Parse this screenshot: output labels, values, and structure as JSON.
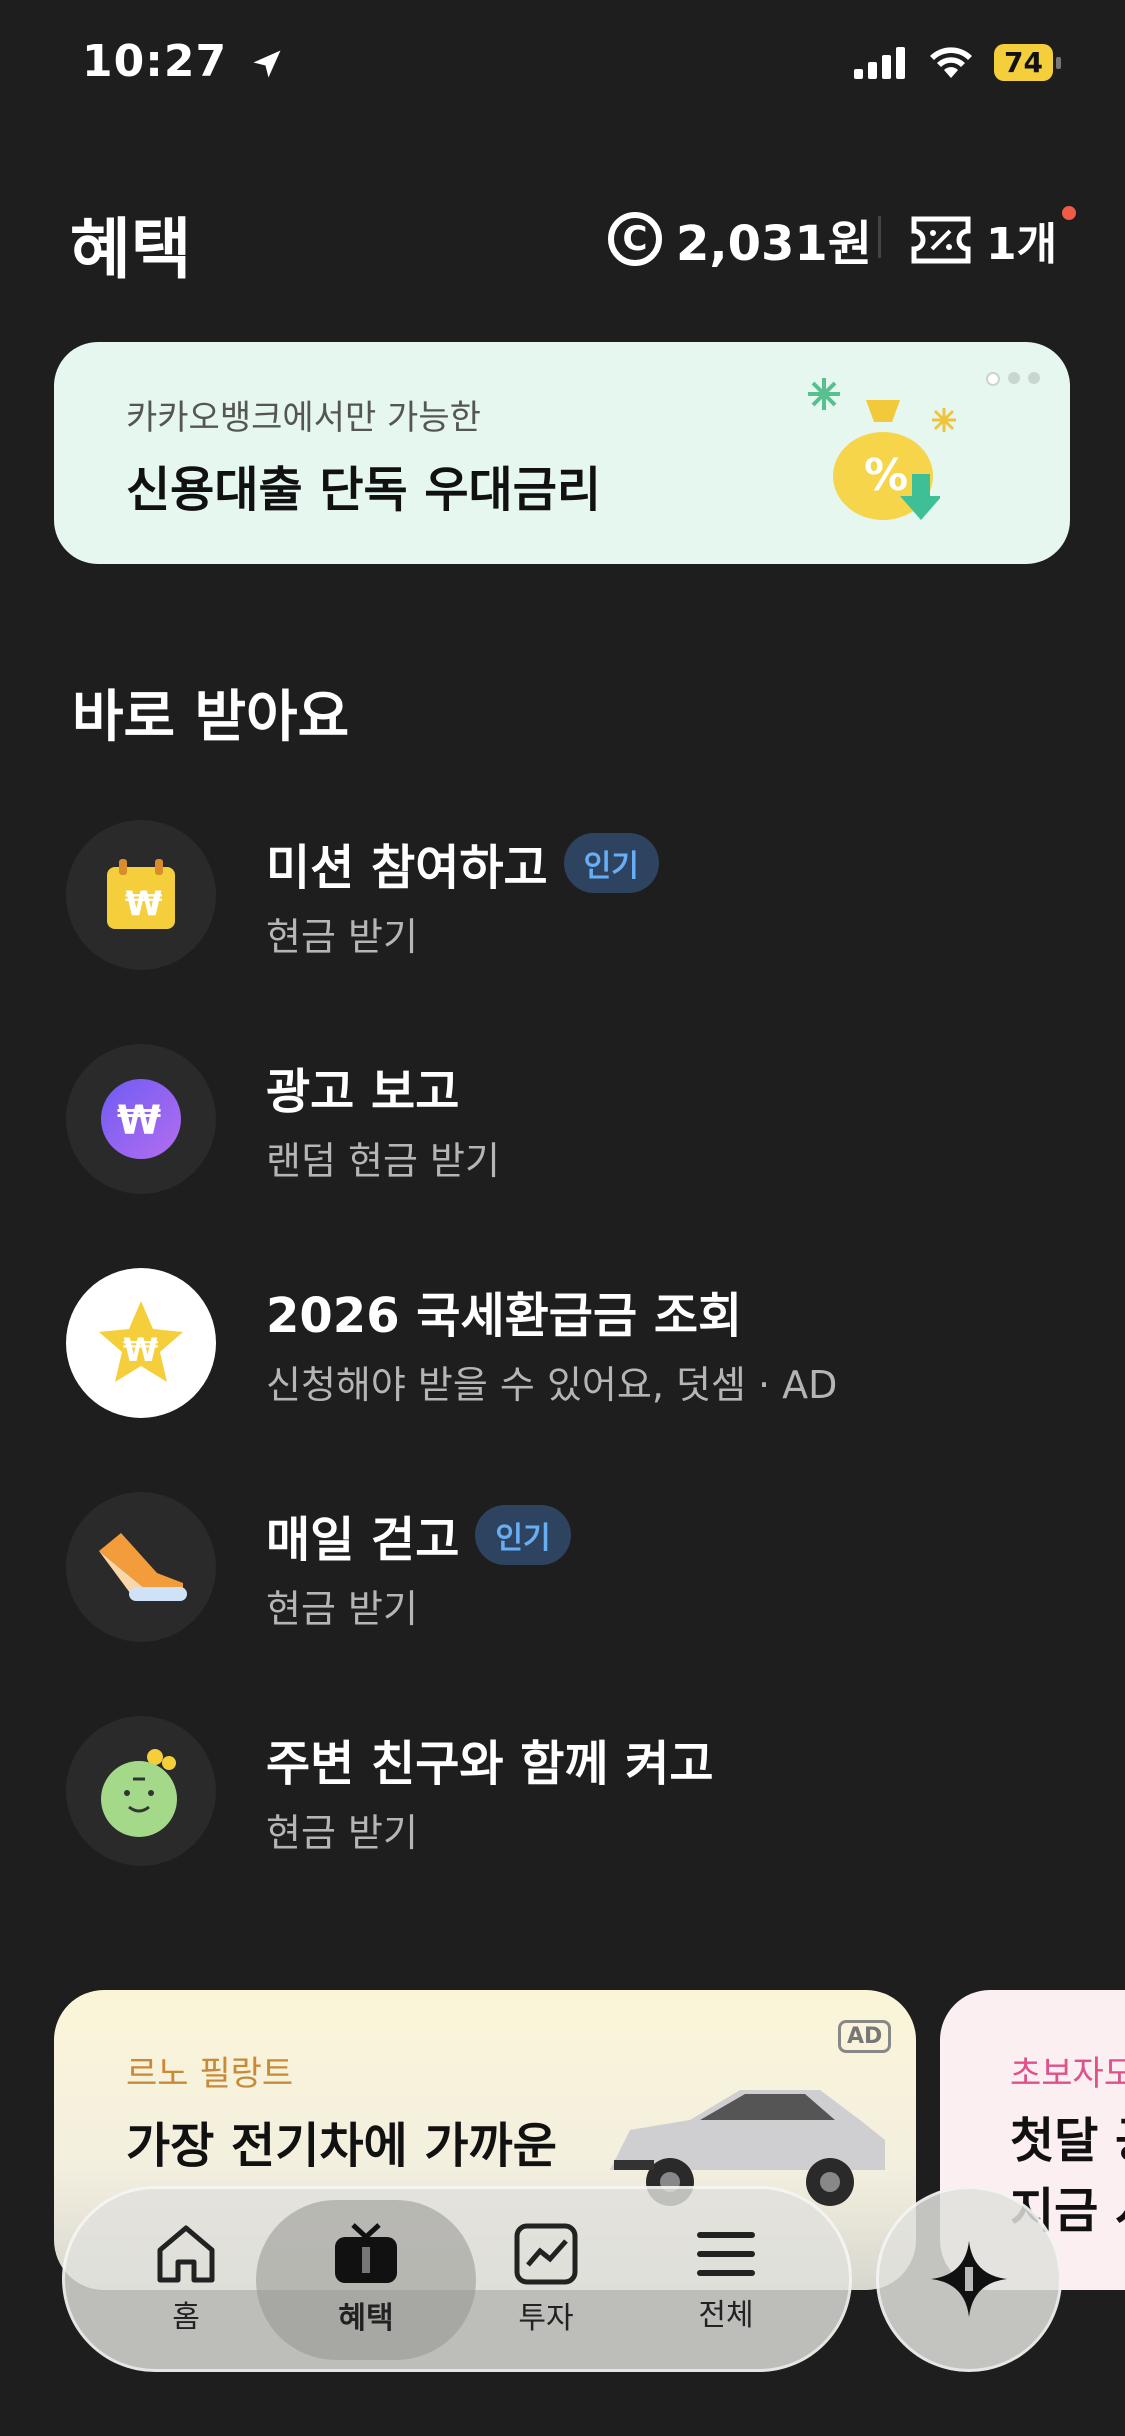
{
  "status_bar": {
    "time": "10:27",
    "battery": "74"
  },
  "header": {
    "title": "혜택",
    "points": "2,031원",
    "coupons": "1개",
    "coin_glyph": "C"
  },
  "banner": {
    "subtitle": "카카오뱅크에서만 가능한",
    "title": "신용대출 단독 우대금리"
  },
  "section": {
    "title": "바로 받아요",
    "items": [
      {
        "title": "미션 참여하고",
        "badge": "인기",
        "subtitle": "현금 받기",
        "icon": "calendar-won-icon"
      },
      {
        "title": "광고 보고",
        "badge": "",
        "subtitle": "랜덤 현금 받기",
        "icon": "purple-w-coin-icon"
      },
      {
        "title": "2026 국세환급금 조회",
        "badge": "",
        "subtitle": "신청해야 받을 수 있어요, 덧셈 · AD",
        "icon": "star-won-icon"
      },
      {
        "title": "매일 걷고",
        "badge": "인기",
        "subtitle": "현금 받기",
        "icon": "sneaker-icon"
      },
      {
        "title": "주변 친구와 함께 켜고",
        "badge": "",
        "subtitle": "현금 받기",
        "icon": "green-character-icon"
      }
    ]
  },
  "ads": [
    {
      "brand": "르노 필랑트",
      "title": "가장 전기차에 가까운",
      "badge": "AD"
    },
    {
      "brand": "초보자도",
      "title_line1": "첫달 공",
      "title_line2": "지금 시"
    }
  ],
  "tabbar": {
    "tabs": [
      {
        "label": "홈"
      },
      {
        "label": "혜택"
      },
      {
        "label": "투자"
      },
      {
        "label": "전체"
      }
    ]
  },
  "colors": {
    "background": "#1e1e1f",
    "banner": "#e5f7ef",
    "pill_bg": "#2e4360",
    "pill_text": "#68aef5",
    "notify_dot": "#ef5b47"
  }
}
